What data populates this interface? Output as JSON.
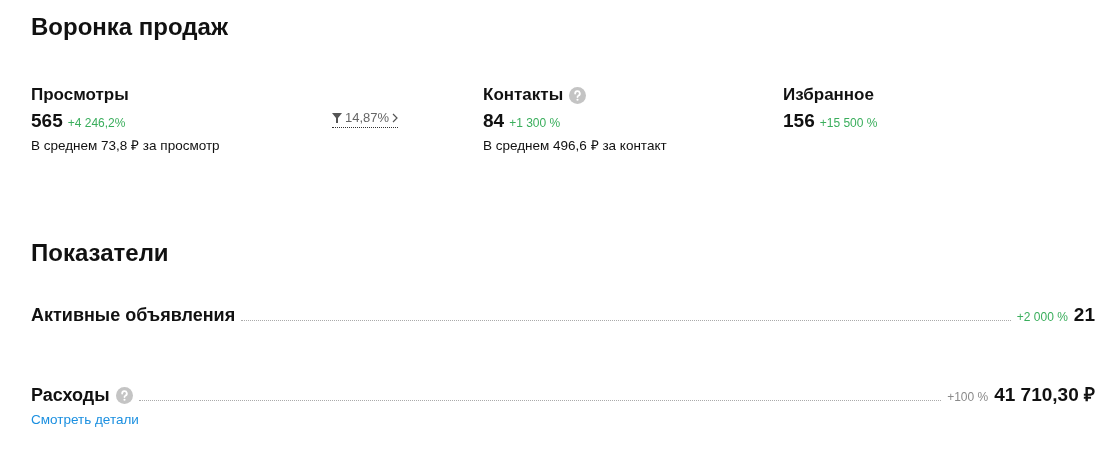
{
  "funnel": {
    "title": "Воронка продаж",
    "stages": [
      {
        "label": "Просмотры",
        "help": false,
        "value": "565",
        "change": {
          "text": "+4 246,2%",
          "color": "#3aae5c"
        },
        "average": "В среднем 73,8 ₽ за просмотр",
        "conversion": "14,87%"
      },
      {
        "label": "Контакты",
        "help": true,
        "value": "84",
        "change": {
          "text": "+1 300 %",
          "color": "#3aae5c"
        },
        "average": "В среднем 496,6 ₽ за контакт"
      },
      {
        "label": "Избранное",
        "help": false,
        "value": "156",
        "change": {
          "text": "+15 500 %",
          "color": "#3aae5c"
        }
      }
    ]
  },
  "metrics": {
    "title": "Показатели",
    "rows": [
      {
        "label": "Активные объявления",
        "help": false,
        "change": {
          "text": "+2 000 %",
          "color": "#3aae5c"
        },
        "value": "21"
      },
      {
        "label": "Расходы",
        "help": true,
        "change": {
          "text": "+100 %",
          "color": "#8a8a8a"
        },
        "value": "41 710,30 ₽",
        "link": "Смотреть детали"
      }
    ]
  }
}
